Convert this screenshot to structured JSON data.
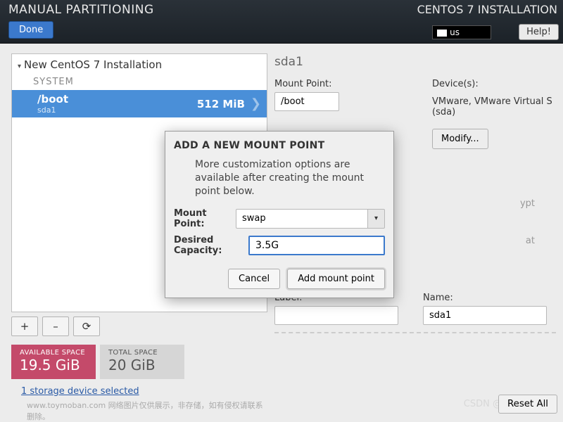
{
  "header": {
    "title": "MANUAL PARTITIONING",
    "right_title": "CENTOS 7 INSTALLATION",
    "done": "Done",
    "lang": "us",
    "help": "Help!"
  },
  "tree": {
    "title": "New CentOS 7 Installation",
    "sys_label": "SYSTEM",
    "row": {
      "mount": "/boot",
      "dev": "sda1",
      "size": "512 MiB"
    },
    "btn_add": "+",
    "btn_remove": "–",
    "btn_reload": "⟳"
  },
  "space": {
    "avail_lbl": "AVAILABLE SPACE",
    "avail_val": "19.5 GiB",
    "total_lbl": "TOTAL SPACE",
    "total_val": "20 GiB"
  },
  "devlink": "1 storage device selected",
  "footnote": "www.toymoban.com 网络图片仅供展示，非存储，如有侵权请联系删除。",
  "detail": {
    "device": "sda1",
    "mp_lbl": "Mount Point:",
    "mp_val": "/boot",
    "devs_lbl": "Device(s):",
    "devs_val": "VMware, VMware Virtual S (sda)",
    "modify": "Modify...",
    "ghost_encrypt": "ypt",
    "ghost_format": "at",
    "label_lbl": "Label:",
    "label_val": "",
    "name_lbl": "Name:",
    "name_val": "sda1",
    "reset": "Reset All"
  },
  "modal": {
    "title": "ADD A NEW MOUNT POINT",
    "desc": "More customization options are available after creating the mount point below.",
    "mp_lbl": "Mount Point:",
    "mp_val": "swap",
    "cap_lbl": "Desired Capacity:",
    "cap_val": "3.5G",
    "cancel": "Cancel",
    "add": "Add mount point"
  },
  "csdn": "CSDN @晴天￥"
}
